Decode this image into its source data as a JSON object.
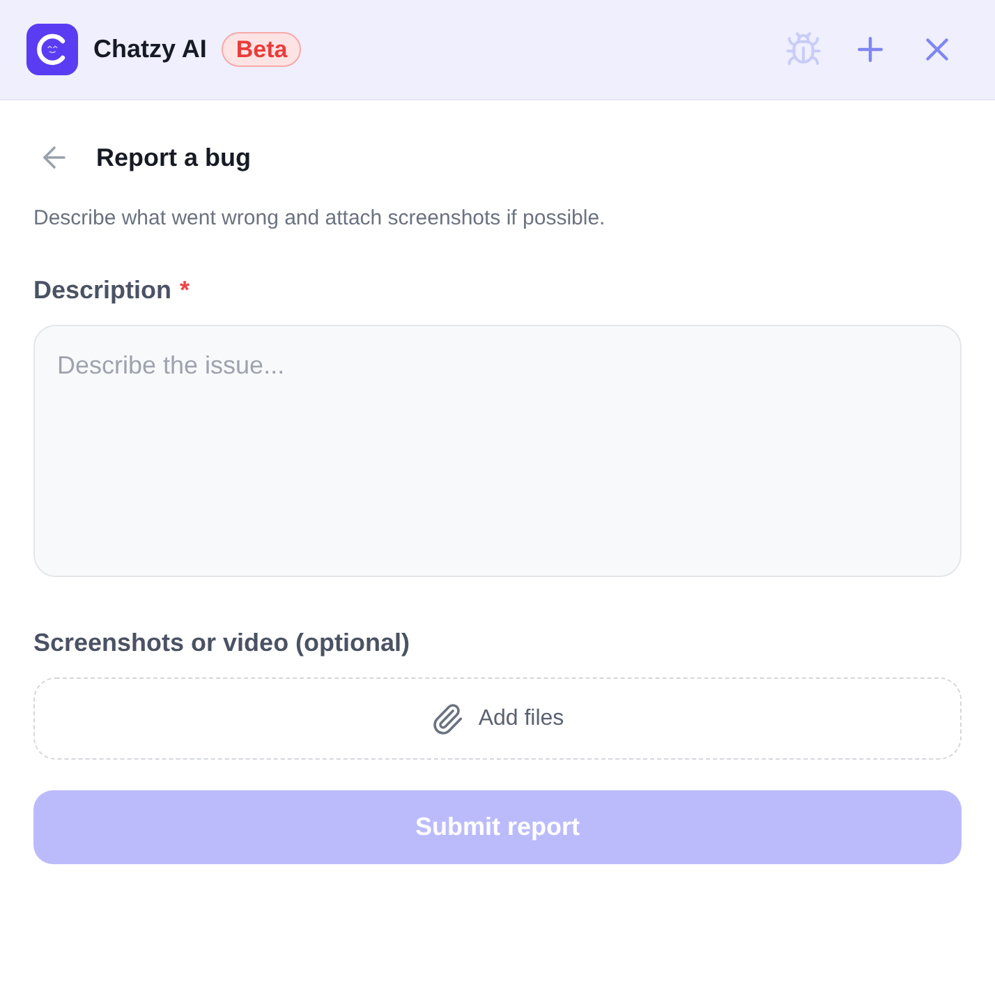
{
  "header": {
    "title": "Chatzy AI",
    "badge": "Beta",
    "actions": [
      {
        "kind": "bug",
        "disabled": true
      },
      {
        "kind": "new",
        "disabled": false
      },
      {
        "kind": "close",
        "disabled": false
      }
    ]
  },
  "page": {
    "title": "Report a bug",
    "subtitle": "Describe what went wrong and attach screenshots if possible."
  },
  "fields": [
    {
      "kind": "textarea",
      "label": "Description",
      "required_mark": "*",
      "placeholder": "Describe the issue..."
    },
    {
      "kind": "dropzone",
      "label": "Screenshots or video (optional)",
      "button": "Add files"
    }
  ],
  "submit": {
    "label": "Submit report",
    "disabled": true
  }
}
